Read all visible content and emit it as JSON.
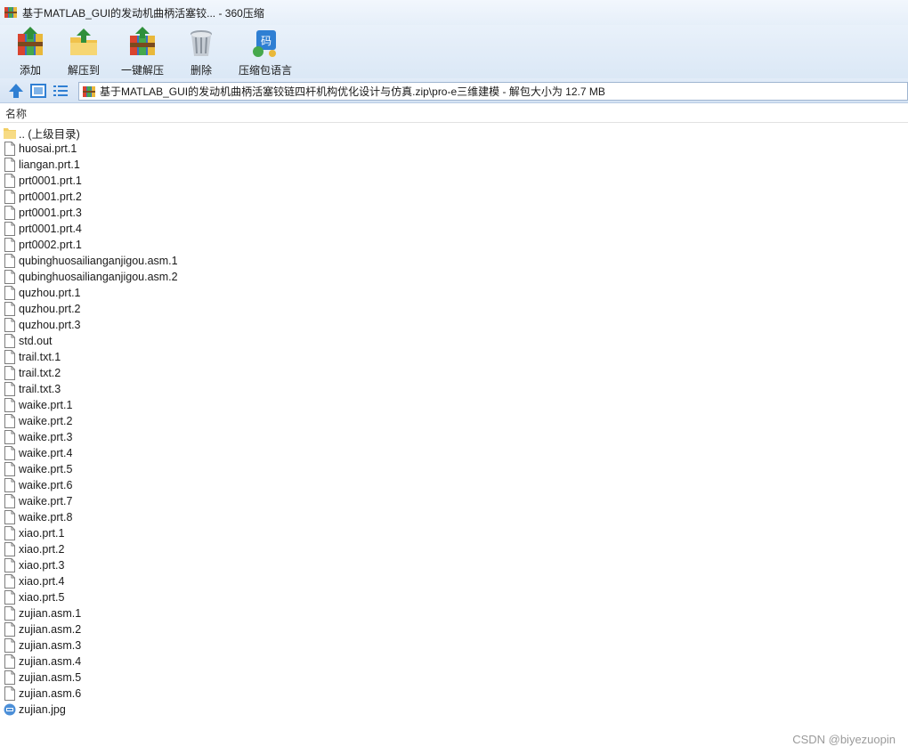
{
  "window": {
    "title": "基于MATLAB_GUI的发动机曲柄活塞铰... - 360压缩"
  },
  "toolbar": {
    "buttons": [
      {
        "label": "添加",
        "icon": "add-archive-icon"
      },
      {
        "label": "解压到",
        "icon": "extract-to-icon"
      },
      {
        "label": "一键解压",
        "icon": "one-click-extract-icon"
      },
      {
        "label": "删除",
        "icon": "delete-icon"
      },
      {
        "label": "压缩包语言",
        "icon": "archive-language-icon"
      }
    ]
  },
  "address": {
    "path": "基于MATLAB_GUI的发动机曲柄活塞铰链四杆机构优化设计与仿真.zip\\pro-e三维建模 - 解包大小为 12.7 MB"
  },
  "columns": {
    "name": "名称"
  },
  "files": [
    {
      "name": ".. (上级目录)",
      "type": "folder"
    },
    {
      "name": "huosai.prt.1",
      "type": "file"
    },
    {
      "name": "liangan.prt.1",
      "type": "file"
    },
    {
      "name": "prt0001.prt.1",
      "type": "file"
    },
    {
      "name": "prt0001.prt.2",
      "type": "file"
    },
    {
      "name": "prt0001.prt.3",
      "type": "file"
    },
    {
      "name": "prt0001.prt.4",
      "type": "file"
    },
    {
      "name": "prt0002.prt.1",
      "type": "file"
    },
    {
      "name": "qubinghuosailianganjigou.asm.1",
      "type": "file"
    },
    {
      "name": "qubinghuosailianganjigou.asm.2",
      "type": "file"
    },
    {
      "name": "quzhou.prt.1",
      "type": "file"
    },
    {
      "name": "quzhou.prt.2",
      "type": "file"
    },
    {
      "name": "quzhou.prt.3",
      "type": "file"
    },
    {
      "name": "std.out",
      "type": "file"
    },
    {
      "name": "trail.txt.1",
      "type": "file"
    },
    {
      "name": "trail.txt.2",
      "type": "file"
    },
    {
      "name": "trail.txt.3",
      "type": "file"
    },
    {
      "name": "waike.prt.1",
      "type": "file"
    },
    {
      "name": "waike.prt.2",
      "type": "file"
    },
    {
      "name": "waike.prt.3",
      "type": "file"
    },
    {
      "name": "waike.prt.4",
      "type": "file"
    },
    {
      "name": "waike.prt.5",
      "type": "file"
    },
    {
      "name": "waike.prt.6",
      "type": "file"
    },
    {
      "name": "waike.prt.7",
      "type": "file"
    },
    {
      "name": "waike.prt.8",
      "type": "file"
    },
    {
      "name": "xiao.prt.1",
      "type": "file"
    },
    {
      "name": "xiao.prt.2",
      "type": "file"
    },
    {
      "name": "xiao.prt.3",
      "type": "file"
    },
    {
      "name": "xiao.prt.4",
      "type": "file"
    },
    {
      "name": "xiao.prt.5",
      "type": "file"
    },
    {
      "name": "zujian.asm.1",
      "type": "file"
    },
    {
      "name": "zujian.asm.2",
      "type": "file"
    },
    {
      "name": "zujian.asm.3",
      "type": "file"
    },
    {
      "name": "zujian.asm.4",
      "type": "file"
    },
    {
      "name": "zujian.asm.5",
      "type": "file"
    },
    {
      "name": "zujian.asm.6",
      "type": "file"
    },
    {
      "name": "zujian.jpg",
      "type": "image"
    }
  ],
  "watermark": "CSDN @biyezuopin",
  "colors": {
    "accent": "#2f7fd3",
    "folder": "#f3cf63",
    "titlebar_bg": "#e6eff9"
  }
}
